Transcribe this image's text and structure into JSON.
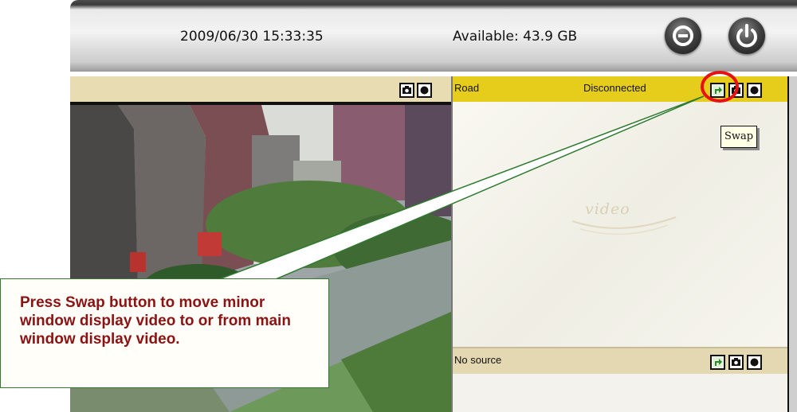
{
  "topbar": {
    "datetime": "2009/06/30 15:33:35",
    "available": "Available: 43.9 GB",
    "minimize_icon": "minus-circle-icon",
    "power_icon": "power-icon"
  },
  "main_panel": {
    "camera_icon": "camera-icon",
    "record_icon": "record-icon"
  },
  "minor_panel": {
    "name": "Road",
    "status": "Disconnected",
    "watermark": "video",
    "swap_icon": "swap-icon",
    "camera_icon": "camera-icon",
    "record_icon": "record-icon"
  },
  "tooltip": {
    "text": "Swap"
  },
  "lower_panel": {
    "name": "No source",
    "swap_icon": "swap-icon",
    "camera_icon": "camera-icon",
    "record_icon": "record-icon"
  },
  "callout": {
    "text": "Press Swap button to move minor window display video to or from main window display video."
  },
  "colors": {
    "highlight": "#e81010",
    "callout_text": "#8c1313",
    "callout_border": "#2f7a2f",
    "minor_header": "#e6cd1c",
    "main_header": "#e8dcb2"
  }
}
